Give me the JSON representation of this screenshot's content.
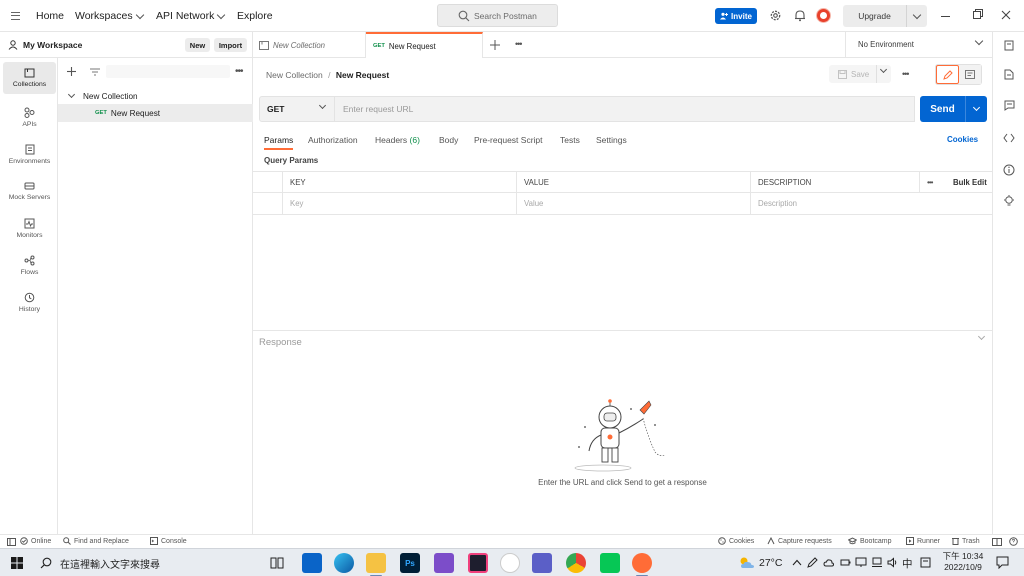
{
  "topbar": {
    "home": "Home",
    "workspaces": "Workspaces",
    "api_network": "API Network",
    "explore": "Explore",
    "search_placeholder": "Search Postman",
    "invite": "Invite",
    "upgrade": "Upgrade"
  },
  "workspace": {
    "name": "My Workspace",
    "new_label": "New",
    "import_label": "Import"
  },
  "rail": {
    "items": [
      {
        "label": "Collections",
        "icon": "collections-icon"
      },
      {
        "label": "APIs",
        "icon": "apis-icon"
      },
      {
        "label": "Environments",
        "icon": "environments-icon"
      },
      {
        "label": "Mock Servers",
        "icon": "mock-servers-icon"
      },
      {
        "label": "Monitors",
        "icon": "monitors-icon"
      },
      {
        "label": "Flows",
        "icon": "flows-icon"
      },
      {
        "label": "History",
        "icon": "history-icon"
      }
    ]
  },
  "sidebar": {
    "collection": "New Collection",
    "request_method": "GET",
    "request_name": "New Request"
  },
  "tabs": {
    "tab1": "New Collection",
    "tab2_method": "GET",
    "tab2": "New Request",
    "environment": "No Environment"
  },
  "request": {
    "breadcrumb_parent": "New Collection",
    "breadcrumb_sep": "/",
    "breadcrumb_current": "New Request",
    "save": "Save",
    "method": "GET",
    "url_placeholder": "Enter request URL",
    "send": "Send",
    "tabs": [
      "Params",
      "Authorization",
      "Headers",
      "Body",
      "Pre-request Script",
      "Tests",
      "Settings"
    ],
    "headers_count": "(6)",
    "cookies": "Cookies",
    "query_params": "Query Params",
    "columns": {
      "key": "KEY",
      "value": "VALUE",
      "description": "DESCRIPTION"
    },
    "bulk_edit": "Bulk Edit",
    "placeholders": {
      "key": "Key",
      "value": "Value",
      "description": "Description"
    }
  },
  "response": {
    "title": "Response",
    "empty_text": "Enter the URL and click Send to get a response"
  },
  "statusbar": {
    "online": "Online",
    "find_replace": "Find and Replace",
    "console": "Console",
    "cookies": "Cookies",
    "capture": "Capture requests",
    "bootcamp": "Bootcamp",
    "runner": "Runner",
    "trash": "Trash"
  },
  "taskbar": {
    "search_placeholder": "在這裡輸入文字來搜尋",
    "weather": "27°C",
    "ime": "中",
    "time": "下午 10:34",
    "date": "2022/10/9"
  },
  "colors": {
    "accent_orange": "#ff6c37",
    "primary_blue": "#0265d2",
    "get_green": "#0f8f4a"
  }
}
